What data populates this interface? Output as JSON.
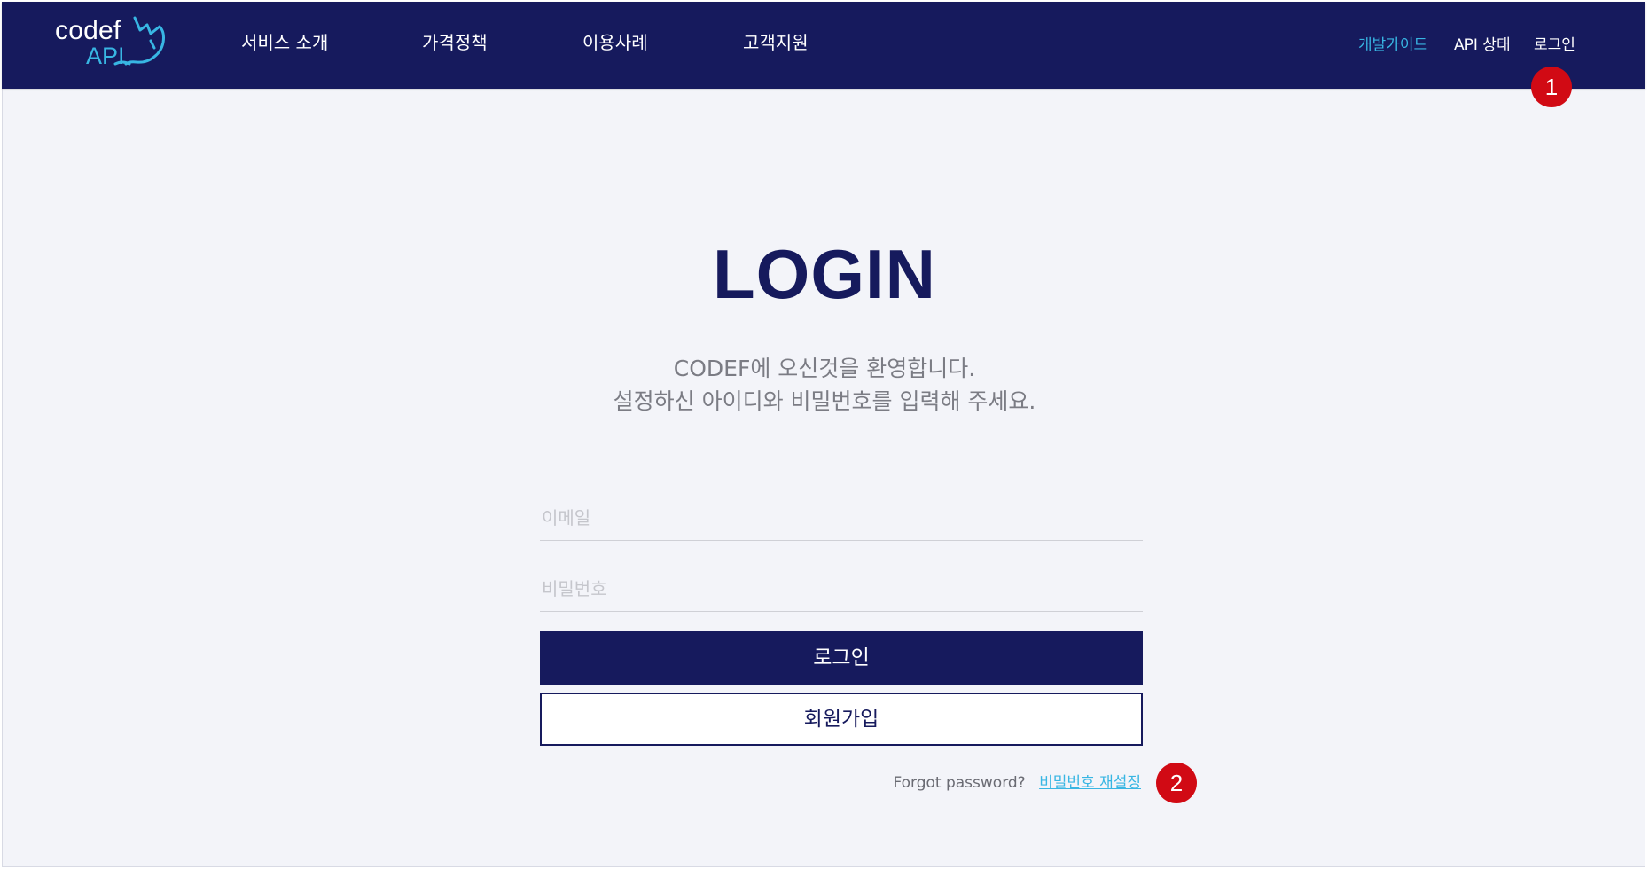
{
  "header": {
    "logo": {
      "line1": "codef",
      "line2": "API"
    },
    "nav": [
      {
        "label": "서비스 소개"
      },
      {
        "label": "가격정책"
      },
      {
        "label": "이용사례"
      },
      {
        "label": "고객지원"
      }
    ],
    "right": {
      "dev_guide": "개발가이드",
      "api_status": "API 상태",
      "login": "로그인"
    }
  },
  "annotations": {
    "badge1": "1",
    "badge2": "2"
  },
  "login": {
    "title": "LOGIN",
    "welcome_line1": "CODEF에 오신것을 환영합니다.",
    "welcome_line2": "설정하신 아이디와 비밀번호를 입력해 주세요.",
    "email_placeholder": "이메일",
    "password_placeholder": "비밀번호",
    "login_button": "로그인",
    "signup_button": "회원가입",
    "forgot_label": "Forgot password?",
    "reset_link": "비밀번호 재설정"
  },
  "colors": {
    "navy": "#161a5d",
    "accent": "#38b6e3",
    "badge": "#d10a14",
    "background": "#f3f4f9"
  },
  "icons": [
    "rhino-logo-icon"
  ]
}
